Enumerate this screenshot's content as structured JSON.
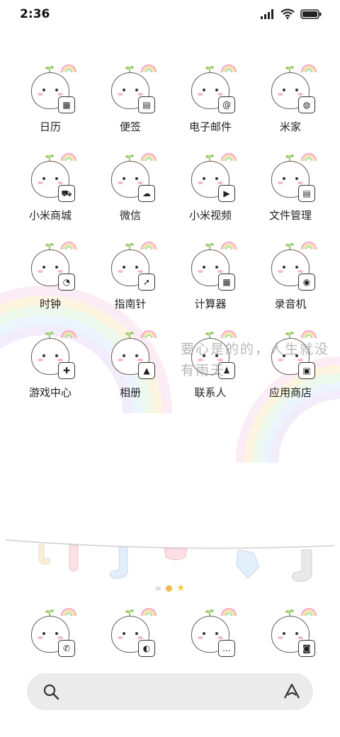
{
  "status_bar": {
    "time": "2:36"
  },
  "apps": [
    {
      "label": "日历",
      "icon": "calendar-icon",
      "badge_glyph": "▦",
      "badge_name": "calendar-badge-icon"
    },
    {
      "label": "便签",
      "icon": "notes-icon",
      "badge_glyph": "▤",
      "badge_name": "notes-badge-icon"
    },
    {
      "label": "电子邮件",
      "icon": "email-icon",
      "badge_glyph": "@",
      "badge_name": "email-badge-icon"
    },
    {
      "label": "米家",
      "icon": "mijia-icon",
      "badge_glyph": "◍",
      "badge_name": "lightbulb-badge-icon"
    },
    {
      "label": "小米商城",
      "icon": "mi-store-icon",
      "badge_glyph": "⛟",
      "badge_name": "cart-badge-icon"
    },
    {
      "label": "微信",
      "icon": "wechat-icon",
      "badge_glyph": "☁",
      "badge_name": "wechat-badge-icon"
    },
    {
      "label": "小米视频",
      "icon": "mi-video-icon",
      "badge_glyph": "▶",
      "badge_name": "video-badge-icon"
    },
    {
      "label": "文件管理",
      "icon": "file-manager-icon",
      "badge_glyph": "▤",
      "badge_name": "file-badge-icon"
    },
    {
      "label": "时钟",
      "icon": "clock-icon",
      "badge_glyph": "◔",
      "badge_name": "clock-badge-icon"
    },
    {
      "label": "指南针",
      "icon": "compass-icon",
      "badge_glyph": "➚",
      "badge_name": "compass-badge-icon"
    },
    {
      "label": "计算器",
      "icon": "calculator-icon",
      "badge_glyph": "▦",
      "badge_name": "calculator-badge-icon"
    },
    {
      "label": "录音机",
      "icon": "recorder-icon",
      "badge_glyph": "◉",
      "badge_name": "recorder-badge-icon"
    },
    {
      "label": "游戏中心",
      "icon": "game-center-icon",
      "badge_glyph": "✚",
      "badge_name": "gamepad-badge-icon"
    },
    {
      "label": "相册",
      "icon": "gallery-icon",
      "badge_glyph": "▲",
      "badge_name": "gallery-badge-icon"
    },
    {
      "label": "联系人",
      "icon": "contacts-icon",
      "badge_glyph": "♟",
      "badge_name": "contacts-badge-icon"
    },
    {
      "label": "应用商店",
      "icon": "app-store-icon",
      "badge_glyph": "▣",
      "badge_name": "app-store-badge-icon"
    }
  ],
  "wallpaper_text": "要心是的的，人生就没有雨天",
  "dock": [
    {
      "icon": "phone-icon",
      "badge_glyph": "✆",
      "badge_name": "phone-badge-icon"
    },
    {
      "icon": "browser-icon",
      "badge_glyph": "◐",
      "badge_name": "browser-badge-icon"
    },
    {
      "icon": "messages-icon",
      "badge_glyph": "…",
      "badge_name": "messages-badge-icon"
    },
    {
      "icon": "camera-icon",
      "badge_glyph": "◙",
      "badge_name": "camera-badge-icon"
    }
  ],
  "page_indicator": {
    "pages": 3,
    "current": 2
  },
  "colors": {
    "dot_active": "#f3b94a",
    "dot_inactive": "#bbbbbb",
    "search_bg": "#ebebeb"
  }
}
